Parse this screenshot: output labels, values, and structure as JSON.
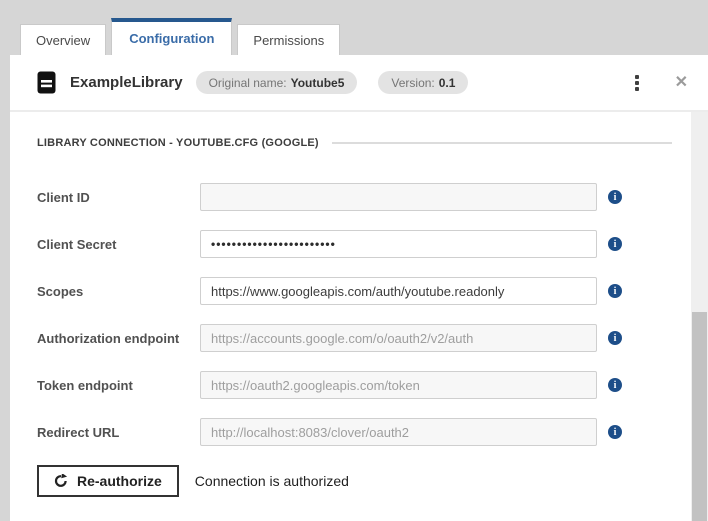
{
  "window": {
    "close_glyph": "✕"
  },
  "tabs": [
    {
      "label": "Overview",
      "active": false
    },
    {
      "label": "Configuration",
      "active": true
    },
    {
      "label": "Permissions",
      "active": false
    }
  ],
  "header": {
    "title": "ExampleLibrary",
    "original_name_label": "Original name:",
    "original_name_value": "Youtube5",
    "version_label": "Version:",
    "version_value": "0.1"
  },
  "section": {
    "title": "LIBRARY CONNECTION - YOUTUBE.CFG (GOOGLE)"
  },
  "fields": [
    {
      "label": "Client ID",
      "value": "",
      "state": "disabled"
    },
    {
      "label": "Client Secret",
      "value": "••••••••••••••••••••••••",
      "state": "masked"
    },
    {
      "label": "Scopes",
      "value": "https://www.googleapis.com/auth/youtube.readonly",
      "state": "filled"
    },
    {
      "label": "Authorization endpoint",
      "placeholder": "https://accounts.google.com/o/oauth2/v2/auth",
      "state": "disabled"
    },
    {
      "label": "Token endpoint",
      "placeholder": "https://oauth2.googleapis.com/token",
      "state": "disabled"
    },
    {
      "label": "Redirect URL",
      "placeholder": "http://localhost:8083/clover/oauth2",
      "state": "disabled"
    }
  ],
  "footer": {
    "reauthorize_label": "Re-authorize",
    "status_text": "Connection is authorized"
  },
  "icons": {
    "info_glyph": "i"
  },
  "colors": {
    "accent_blue": "#26588e",
    "tab_active_text": "#3a6ca8",
    "info_icon_bg": "#1d4e89",
    "badge_bg": "#e3e3e3",
    "chrome_bg": "#d6d6d6"
  }
}
